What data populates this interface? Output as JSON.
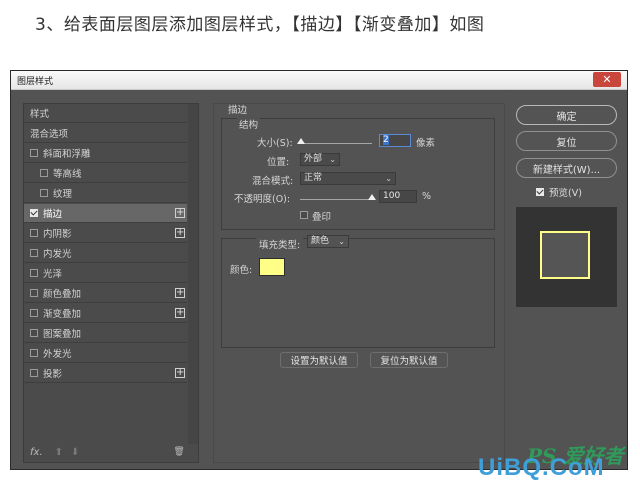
{
  "caption": "3、给表面层图层添加图层样式，【描边】【渐变叠加】如图",
  "window": {
    "title": "图层样式",
    "close_glyph": "✕"
  },
  "style_list": {
    "header": "样式",
    "blend_options": "混合选项",
    "items": [
      {
        "label": "斜面和浮雕",
        "checked": false,
        "plus": false
      },
      {
        "label": "等高线",
        "checked": false,
        "plus": false
      },
      {
        "label": "纹理",
        "checked": false,
        "plus": false
      },
      {
        "label": "描边",
        "checked": true,
        "plus": true,
        "selected": true
      },
      {
        "label": "内阴影",
        "checked": false,
        "plus": true
      },
      {
        "label": "内发光",
        "checked": false,
        "plus": false
      },
      {
        "label": "光泽",
        "checked": false,
        "plus": false
      },
      {
        "label": "颜色叠加",
        "checked": false,
        "plus": true
      },
      {
        "label": "渐变叠加",
        "checked": false,
        "plus": true
      },
      {
        "label": "图案叠加",
        "checked": false,
        "plus": false
      },
      {
        "label": "外发光",
        "checked": false,
        "plus": false
      },
      {
        "label": "投影",
        "checked": false,
        "plus": true
      }
    ],
    "footer": {
      "fx": "fx.",
      "up": "⬆",
      "down": "⬇",
      "trash": "🗑"
    }
  },
  "stroke_panel": {
    "section_title": "描边",
    "structure_title": "结构",
    "size_label": "大小(S):",
    "size_value": "2",
    "size_unit": "像素",
    "size_fraction": 0.02,
    "position_label": "位置:",
    "position_value": "外部",
    "blend_label": "混合模式:",
    "blend_value": "正常",
    "opacity_label": "不透明度(O):",
    "opacity_value": "100",
    "opacity_unit": "%",
    "opacity_fraction": 1.0,
    "overprint_label": "叠印",
    "fill_type_label": "填充类型:",
    "fill_type_value": "颜色",
    "color_label": "颜色:",
    "stroke_color": "#ffff88",
    "set_default": "设置为默认值",
    "reset_default": "复位为默认值"
  },
  "right_panel": {
    "ok": "确定",
    "reset": "复位",
    "new_style": "新建样式(W)...",
    "preview_label": "预览(V)",
    "preview_checked": true
  },
  "watermark": {
    "line1": "PS 爱好者",
    "line2": "UiBQ.CoM"
  }
}
